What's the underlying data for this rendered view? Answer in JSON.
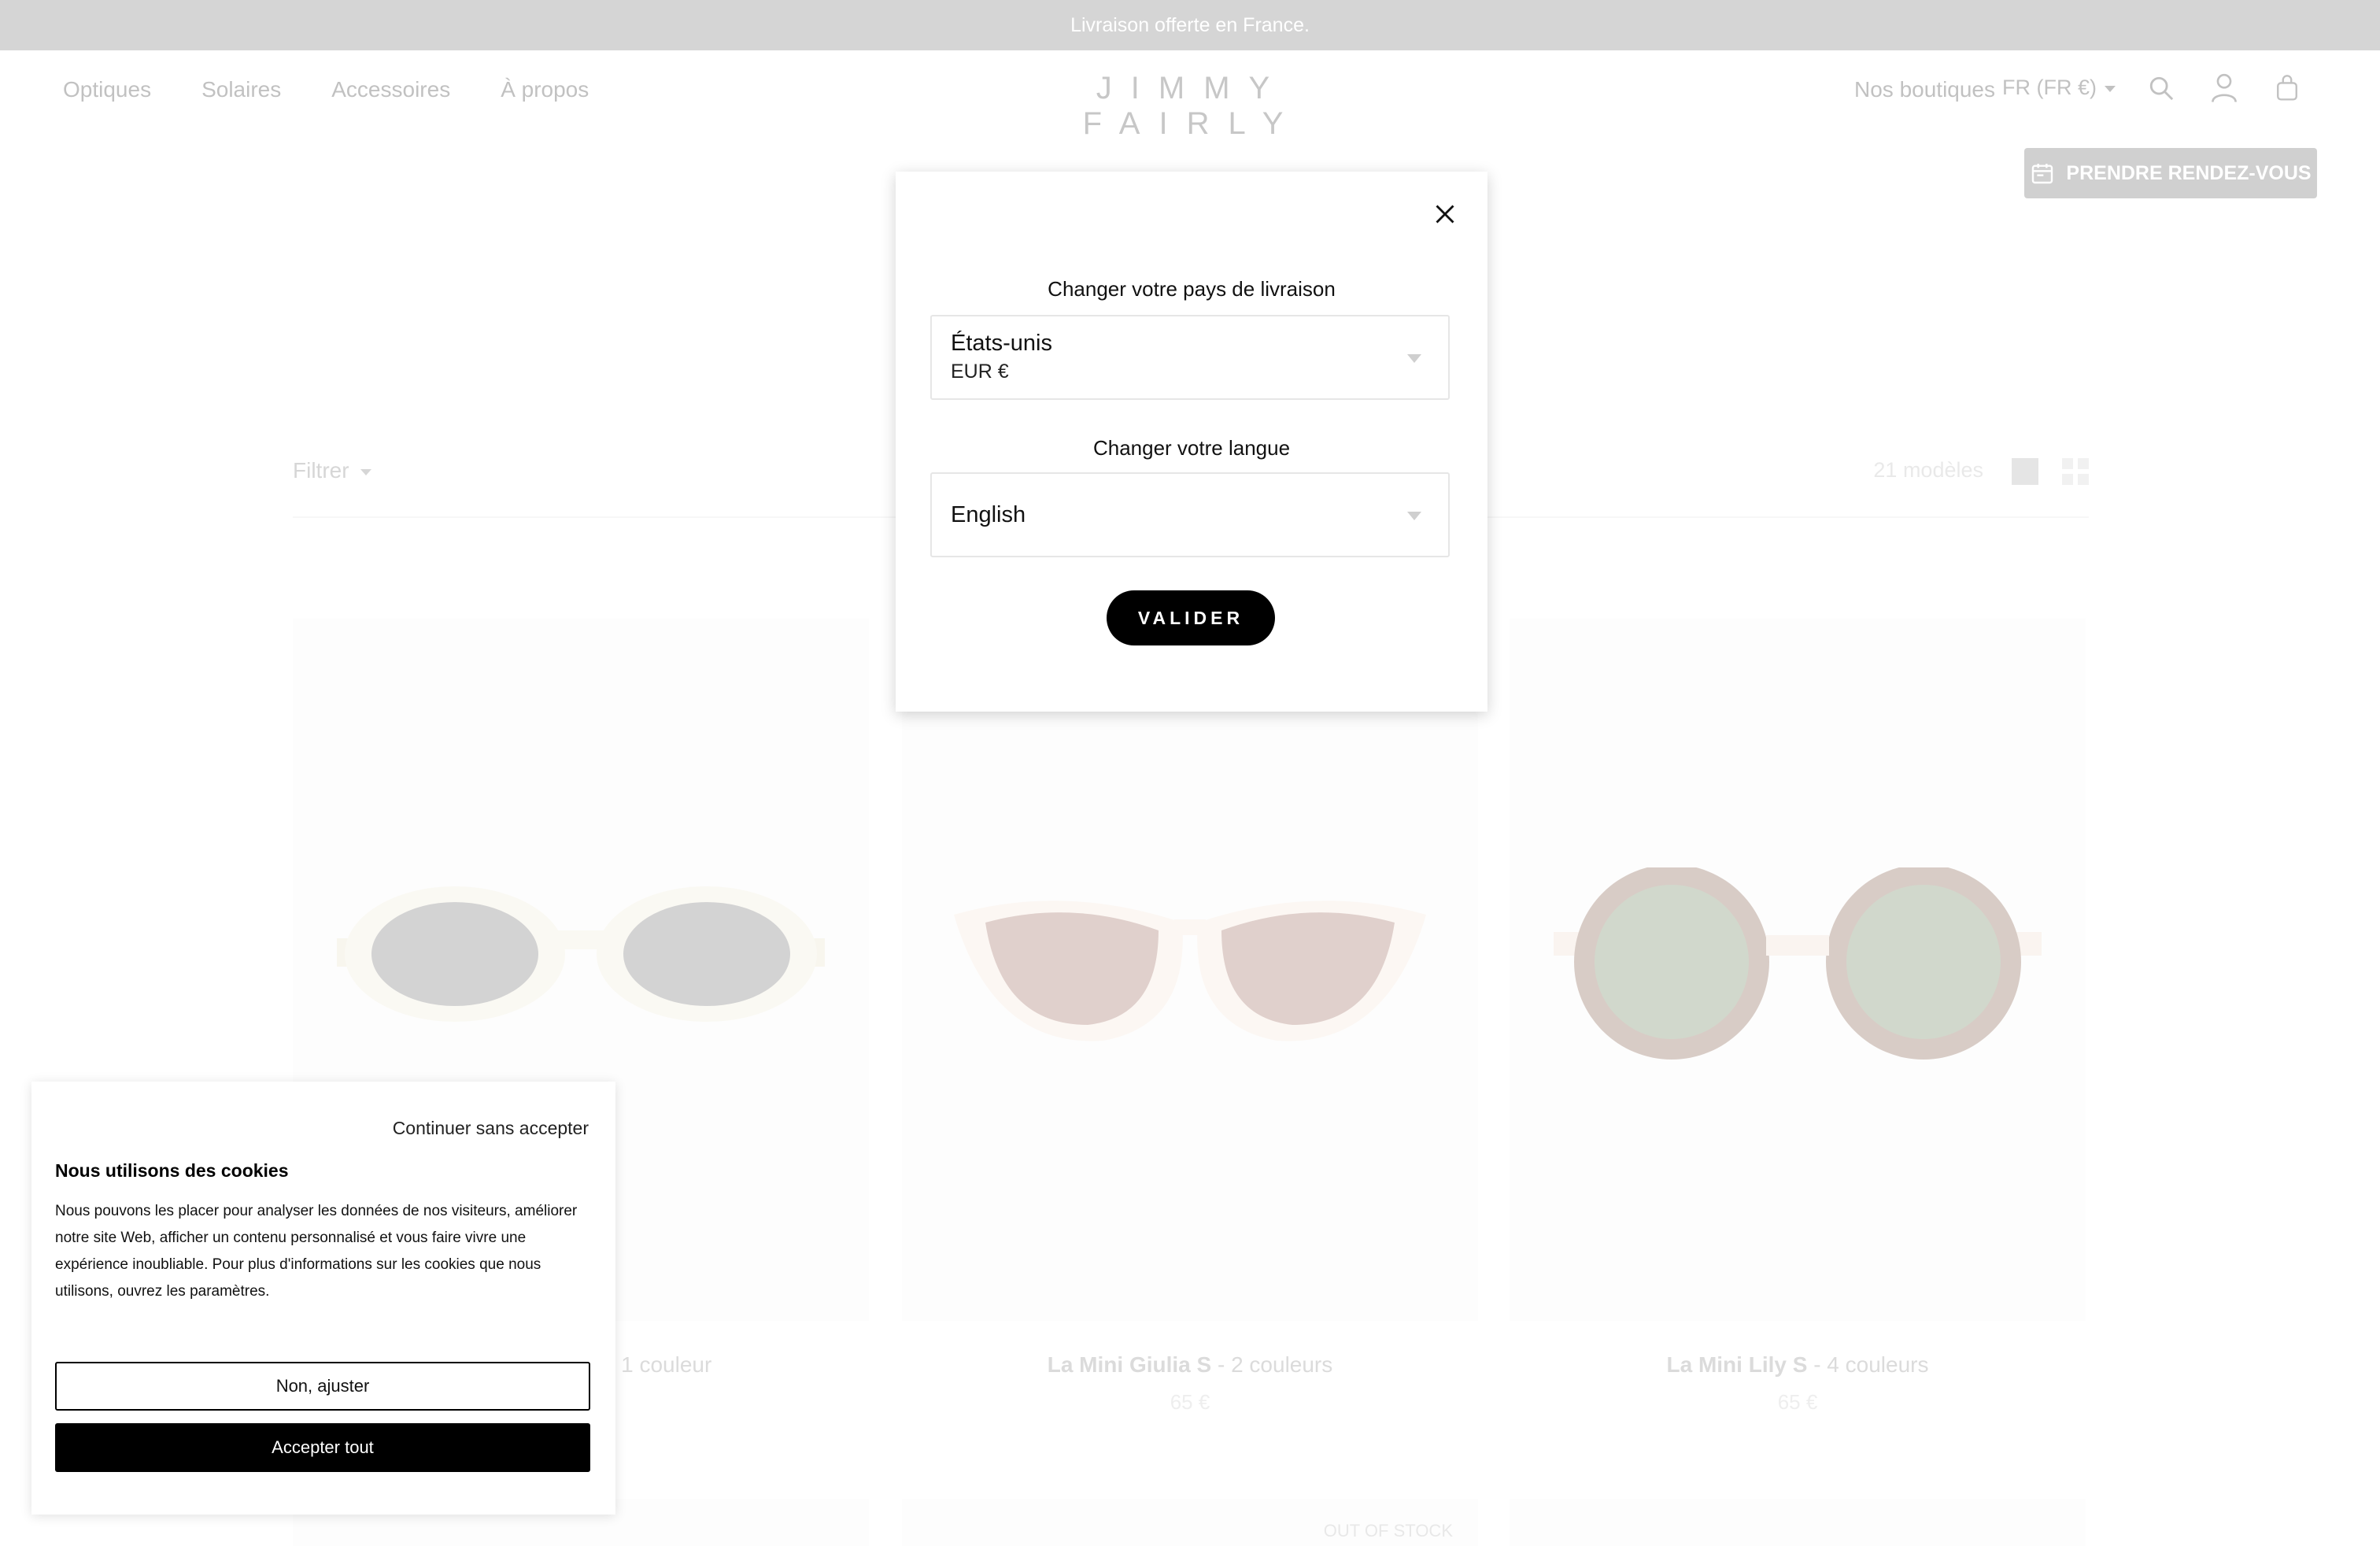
{
  "banner": {
    "text": "Livraison offerte en France."
  },
  "header": {
    "nav": [
      "Optiques",
      "Solaires",
      "Accessoires",
      "À propos"
    ],
    "logo": "JIMMY FAIRLY",
    "stores": "Nos boutiques",
    "locale": "FR (FR €)"
  },
  "appointment": {
    "label": "PRENDRE RENDEZ-VOUS"
  },
  "listing": {
    "filter_label": "Filtrer",
    "count": "21 modèles"
  },
  "products": [
    {
      "name": "",
      "variants": "- 1 couleur",
      "price": ""
    },
    {
      "name": "La Mini Giulia S",
      "variants": "- 2 couleurs",
      "price": "65 €"
    },
    {
      "name": "La Mini Lily S",
      "variants": "- 4 couleurs",
      "price": "65 €"
    }
  ],
  "second_row": {
    "badge": "OUT OF STOCK"
  },
  "modal": {
    "country_label": "Changer votre pays de livraison",
    "country_value": "États-unis",
    "currency_value": "EUR €",
    "language_label": "Changer votre langue",
    "language_value": "English",
    "submit": "VALIDER"
  },
  "cookie": {
    "skip": "Continuer sans accepter",
    "title": "Nous utilisons des cookies",
    "body": "Nous pouvons les placer pour analyser les données de nos visiteurs, améliorer notre site Web, afficher un contenu personnalisé et vous faire vivre une expérience inoubliable. Pour plus d'informations sur les cookies que nous utilisons, ouvrez les paramètres.",
    "adjust": "Non, ajuster",
    "accept": "Accepter tout"
  },
  "colors": {
    "banner_bg": "#b3b3b3",
    "button_dark": "#000000",
    "appointment_bg": "#9c9c9c"
  }
}
